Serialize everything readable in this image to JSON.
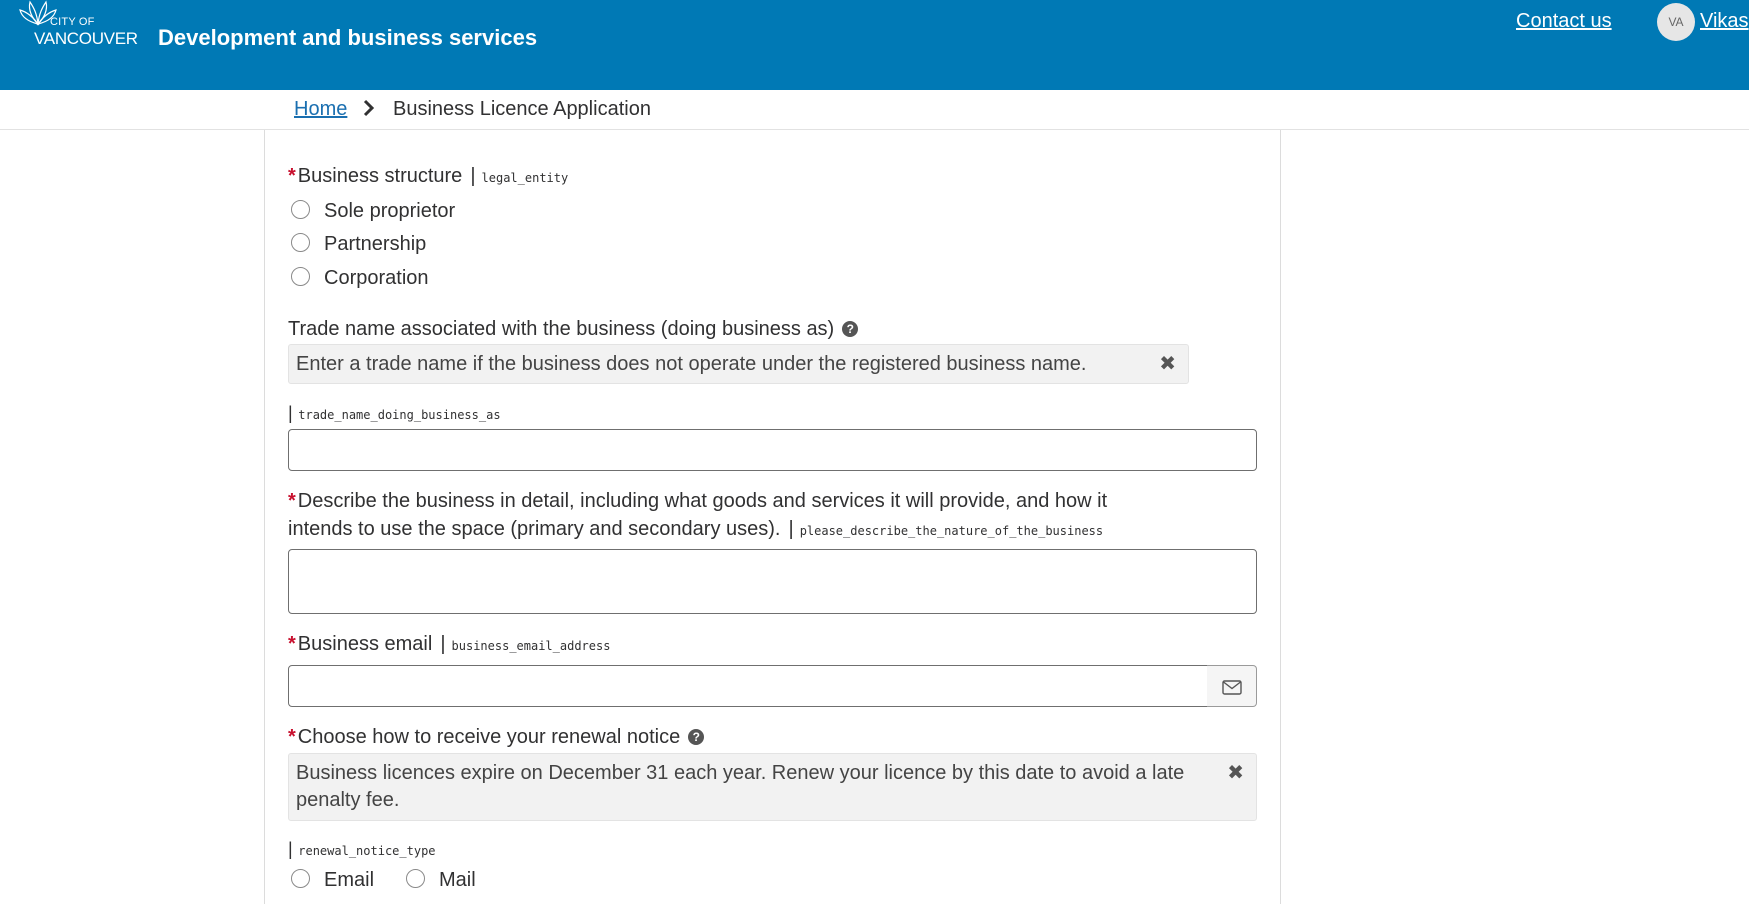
{
  "header": {
    "logo_top": "CITY OF",
    "logo_bottom": "VANCOUVER",
    "title": "Development and business services",
    "contact_label": "Contact us",
    "avatar_initials": "VA",
    "user_name": "Vikas"
  },
  "breadcrumb": {
    "home": "Home",
    "current": "Business Licence Application"
  },
  "form": {
    "business_structure": {
      "label": "Business structure",
      "key": "legal_entity",
      "options": [
        "Sole proprietor",
        "Partnership",
        "Corporation"
      ]
    },
    "trade_name": {
      "label": "Trade name associated with the business (doing business as)",
      "help": "Enter a trade name if the business does not operate under the registered business name.",
      "key": "trade_name_doing_business_as",
      "value": ""
    },
    "description": {
      "label_line1": "Describe the business in detail, including what goods and services it will provide, and how it",
      "label_line2": "intends to use the space (primary and secondary uses).",
      "key": "please_describe_the_nature_of_the_business",
      "value": ""
    },
    "business_email": {
      "label": "Business email",
      "key": "business_email_address",
      "value": "",
      "icon": "envelope-icon"
    },
    "renewal_notice": {
      "label": "Choose how to receive your renewal notice",
      "help": "Business licences expire on December 31 each year. Renew your licence by this date to avoid a late penalty fee.",
      "key": "renewal_notice_type",
      "options": [
        "Email",
        "Mail"
      ]
    }
  },
  "colors": {
    "header_bg": "#0079b5",
    "required": "#c8102e",
    "link": "#1a6fb0"
  }
}
